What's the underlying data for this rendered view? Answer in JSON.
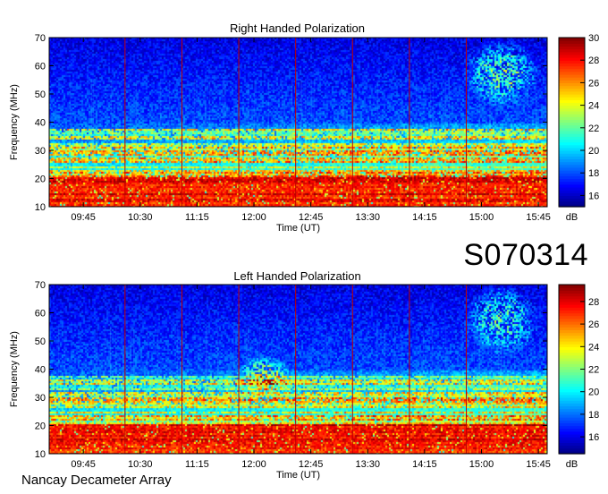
{
  "stamp": "S070314",
  "footer": "Nancay Decameter Array",
  "chart_data": [
    {
      "type": "heatmap",
      "title": "Right Handed Polarization",
      "xlabel": "Time (UT)",
      "ylabel": "Frequency (MHz)",
      "xticks": [
        "09:45",
        "10:30",
        "11:15",
        "12:00",
        "12:45",
        "13:30",
        "14:15",
        "15:00",
        "15:45"
      ],
      "xlim": [
        "09:18",
        "15:52"
      ],
      "ylim": [
        10,
        70
      ],
      "yticks": [
        10,
        20,
        30,
        40,
        50,
        60,
        70
      ],
      "colorbar": {
        "label": "dB",
        "min": 15,
        "max": 30,
        "ticks": [
          16,
          18,
          20,
          22,
          24,
          26,
          28,
          30
        ]
      },
      "vertical_markers": [
        "10:18",
        "11:03",
        "11:48",
        "12:33",
        "13:18",
        "14:03",
        "14:48"
      ],
      "features": [
        {
          "description": "intense interference band",
          "freq_range": [
            10,
            21
          ],
          "level_db": 29
        },
        {
          "description": "horizontal interference lines",
          "freq_range": [
            21,
            36
          ],
          "level_db": 25
        },
        {
          "description": "quiet background",
          "freq_range": [
            40,
            70
          ],
          "level_db": 18
        },
        {
          "description": "emission patches",
          "time": "14:45-15:45",
          "freq_range": [
            45,
            70
          ],
          "level_db": 23
        }
      ]
    },
    {
      "type": "heatmap",
      "title": "Left Handed Polarization",
      "xlabel": "Time (UT)",
      "ylabel": "Frequency (MHz)",
      "xticks": [
        "09:45",
        "10:30",
        "11:15",
        "12:00",
        "12:45",
        "13:30",
        "14:15",
        "15:00",
        "15:45"
      ],
      "xlim": [
        "09:18",
        "15:52"
      ],
      "ylim": [
        10,
        70
      ],
      "yticks": [
        10,
        20,
        30,
        40,
        50,
        60,
        70
      ],
      "colorbar": {
        "label": "dB",
        "min": 14.5,
        "max": 29.5,
        "ticks": [
          16,
          18,
          20,
          22,
          24,
          26,
          28
        ]
      },
      "vertical_markers": [
        "10:18",
        "11:03",
        "11:48",
        "12:33",
        "13:18",
        "14:03",
        "14:48"
      ],
      "features": [
        {
          "description": "intense interference band",
          "freq_range": [
            10,
            22
          ],
          "level_db": 28
        },
        {
          "description": "broad enhancement",
          "time": "11:45-12:30",
          "freq_range": [
            30,
            45
          ],
          "level_db": 24
        },
        {
          "description": "quiet background",
          "freq_range": [
            45,
            70
          ],
          "level_db": 18
        },
        {
          "description": "emission patches",
          "time": "14:45-15:45",
          "freq_range": [
            45,
            70
          ],
          "level_db": 22
        }
      ]
    }
  ]
}
